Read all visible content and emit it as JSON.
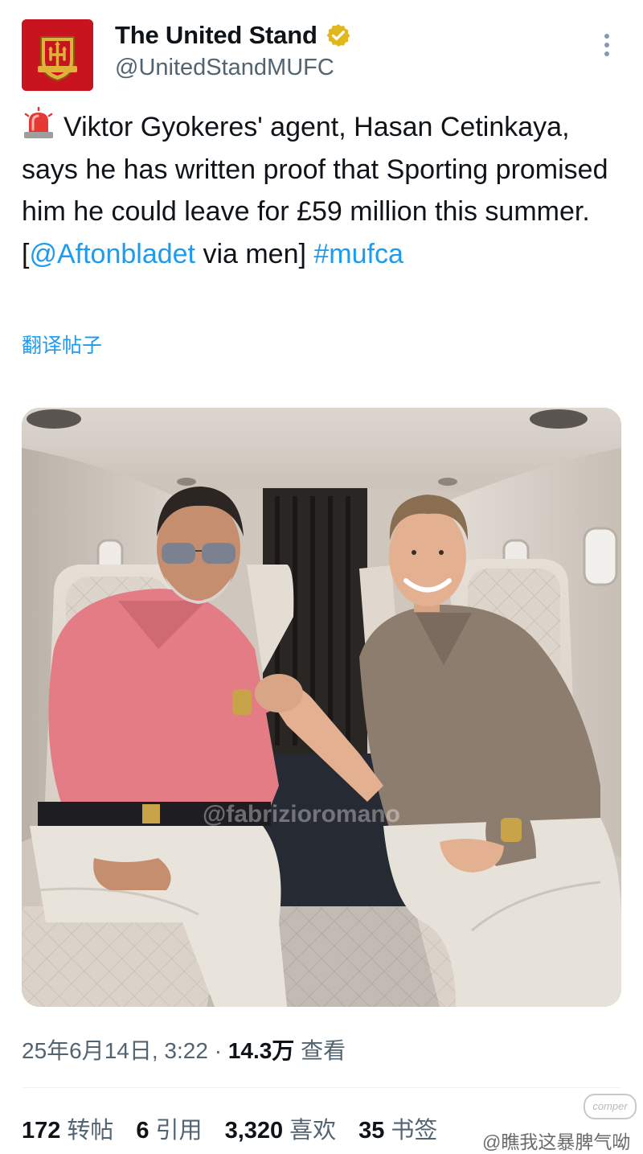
{
  "post": {
    "author_name": "The United Stand",
    "author_handle": "@UnitedStandMUFC",
    "text_part1": "Viktor Gyokeres' agent, Hasan Cetinkaya, says he has written proof that Sporting promised him he could leave for £59 million this summer. [",
    "mention": "@Aftonbladet",
    "text_part2": " via men] ",
    "hashtag": "#mufca",
    "translate_label": "翻译帖子",
    "photo_watermark": "@fabrizioromano",
    "timestamp": "25年6月14日, 3:22",
    "separator": "·",
    "views_count": "14.3万",
    "views_label": "查看"
  },
  "stats": {
    "reposts_count": "172",
    "reposts_label": "转帖",
    "quotes_count": "6",
    "quotes_label": "引用",
    "likes_count": "3,320",
    "likes_label": "喜欢",
    "bookmarks_count": "35",
    "bookmarks_label": "书签"
  },
  "watermark": {
    "logo_text": "comper",
    "user_text": "@瞧我这暴脾气呦"
  },
  "colors": {
    "link": "#1d9bf0",
    "text": "#0f1419",
    "muted": "#536471",
    "verified_badge": "#e2b719",
    "avatar_bg": "#c8141f"
  },
  "icons": {
    "siren": "rotating-light-emoji",
    "verified": "verified-badge-icon",
    "more": "more-vertical-icon"
  }
}
